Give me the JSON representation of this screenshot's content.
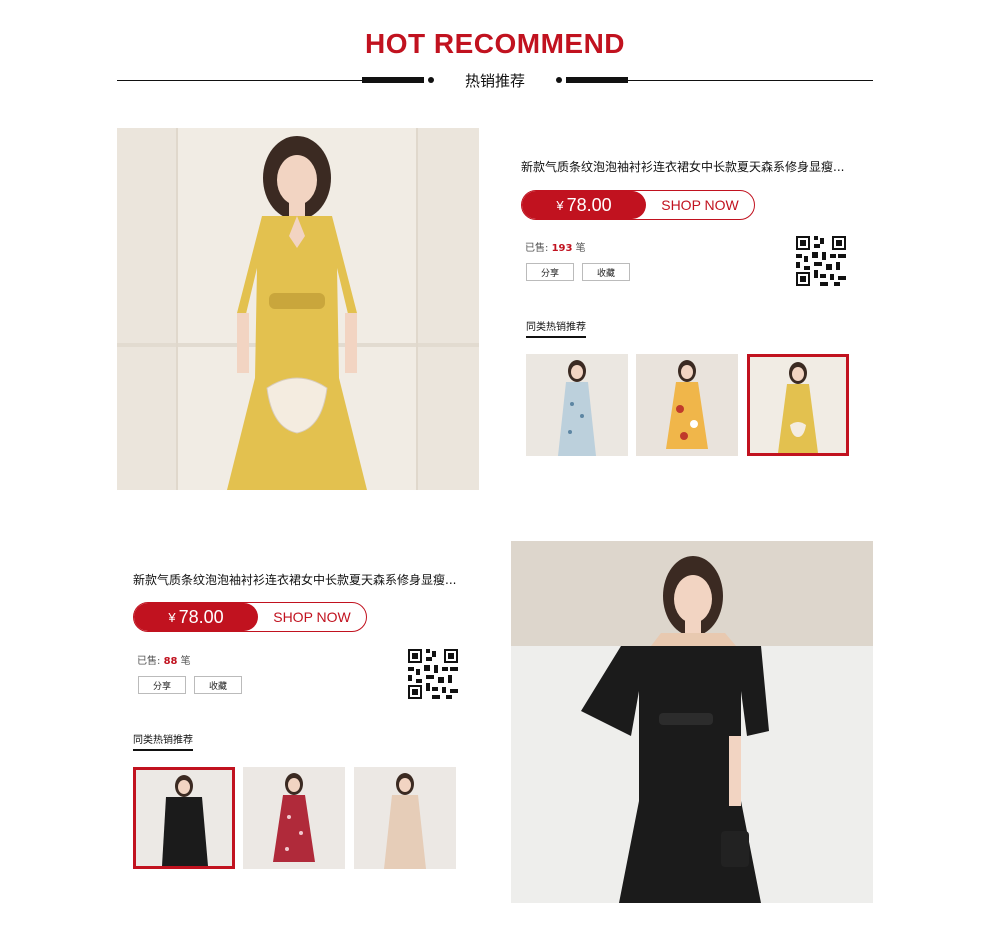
{
  "header": {
    "title": "HOT RECOMMEND",
    "subtitle": "热销推荐"
  },
  "products": [
    {
      "title": "新款气质条纹泡泡袖衬衫连衣裙女中长款夏天森系修身显瘦...",
      "currency": "¥",
      "price": "78.00",
      "shop_label": "SHOP NOW",
      "sold_prefix": "已售:",
      "sold_count": "193",
      "sold_suffix": "笔",
      "share_label": "分享",
      "fav_label": "收藏",
      "rec_label": "同类热销推荐",
      "dress_color": "#e3c14f",
      "thumbs": [
        {
          "name": "blue floral dress",
          "color": "#bcd0dc"
        },
        {
          "name": "yellow floral dress",
          "color": "#f0b64a"
        },
        {
          "name": "yellow dress",
          "color": "#e3c14f",
          "active": true
        }
      ]
    },
    {
      "title": "新款气质条纹泡泡袖衬衫连衣裙女中长款夏天森系修身显瘦...",
      "currency": "¥",
      "price": "78.00",
      "shop_label": "SHOP NOW",
      "sold_prefix": "已售:",
      "sold_count": "88",
      "sold_suffix": "笔",
      "share_label": "分享",
      "fav_label": "收藏",
      "rec_label": "同类热销推荐",
      "dress_color": "#1b1b1b",
      "thumbs": [
        {
          "name": "black dress",
          "color": "#1b1b1b",
          "active": true
        },
        {
          "name": "red floral dress",
          "color": "#b02a3a"
        },
        {
          "name": "beige dress",
          "color": "#e6cdb8"
        }
      ]
    }
  ],
  "colors": {
    "accent": "#c1121f"
  }
}
